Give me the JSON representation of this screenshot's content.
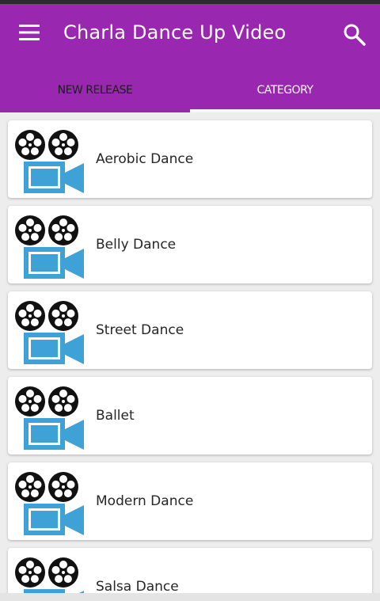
{
  "app_bar": {
    "title": "Charla Dance Up Video",
    "menu_icon": "hamburger-menu-icon",
    "search_icon": "search-icon",
    "color": "#9a27b0"
  },
  "tabs": [
    {
      "label": "NEW RELEASE",
      "active": true
    },
    {
      "label": "CATEGORY",
      "active": false
    }
  ],
  "list": {
    "thumbnail_icon": "video-camera-icon",
    "items": [
      {
        "label": "Aerobic Dance"
      },
      {
        "label": "Belly Dance"
      },
      {
        "label": "Street Dance"
      },
      {
        "label": "Ballet"
      },
      {
        "label": "Modern Dance"
      },
      {
        "label": "Salsa Dance"
      }
    ]
  }
}
